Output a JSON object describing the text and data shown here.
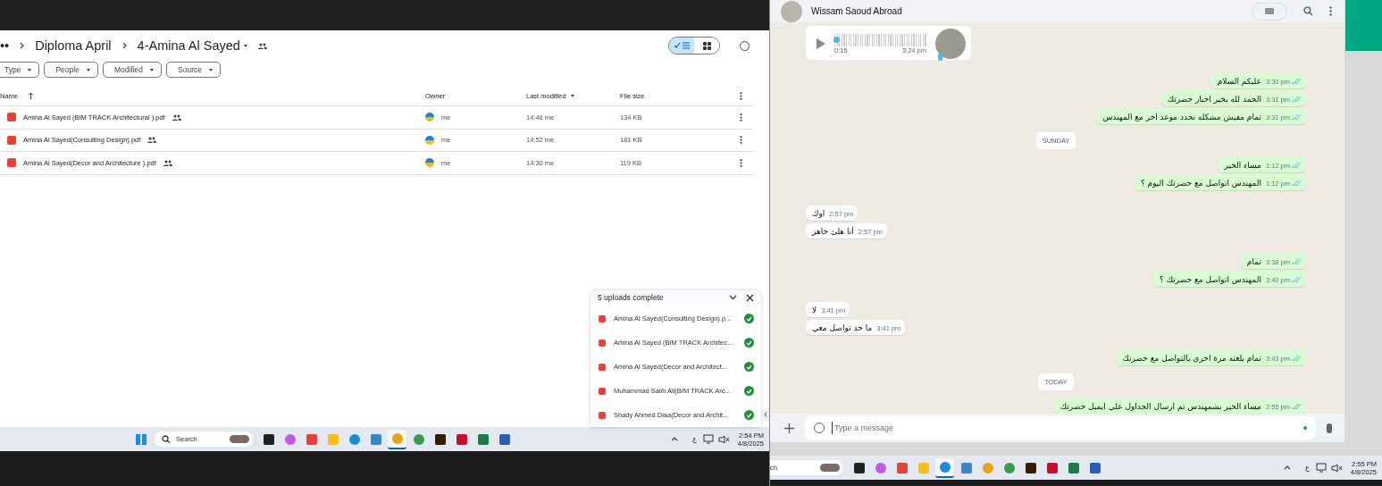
{
  "drive": {
    "breadcrumb": {
      "overflow": "••",
      "parent": "Diploma April",
      "current": "4-Amina Al Sayed"
    },
    "view_toggle": [
      {
        "kind": "list",
        "selected": true
      },
      {
        "kind": "grid",
        "selected": false
      }
    ],
    "filters": [
      "Type",
      "People",
      "Modified",
      "Source"
    ],
    "table": {
      "columns": [
        {
          "label": "Name",
          "sorted": true,
          "descending": false
        },
        {
          "label": "Owner",
          "sorted": false
        },
        {
          "label": "Last modified",
          "sorted": true,
          "descending": true
        },
        {
          "label": "File size",
          "sorted": false
        }
      ],
      "rows": [
        {
          "name": "Amina Al Sayed (BIM TRACK Architectural ).pdf",
          "shared": true,
          "owner": "me",
          "modified": "14:46 me",
          "size": "134 KB"
        },
        {
          "name": "Amina Al Sayed(Consulting Design).pdf",
          "shared": true,
          "owner": "me",
          "modified": "14:52 me",
          "size": "181 KB"
        },
        {
          "name": "Amina Al Sayed(Decor and Architecture ).pdf",
          "shared": true,
          "owner": "me",
          "modified": "14:30 me",
          "size": "119 KB"
        }
      ]
    },
    "uploads": {
      "title": "5 uploads complete",
      "items": [
        {
          "name": "Amina Al Sayed(Consulting Design).p...",
          "done": true
        },
        {
          "name": "Amina Al Sayed (BIM TRACK Architec...",
          "done": true
        },
        {
          "name": "Amina Al Sayed(Decor and Architect...",
          "done": true
        },
        {
          "name": "Muhammad Salih Ali(BIM TRACK Arc...",
          "done": true
        },
        {
          "name": "Shady Ahmed Diaa(Decor and Archit...",
          "done": true
        }
      ]
    },
    "taskbar": {
      "search": "Search",
      "lang": "ع",
      "time": "2:54 PM",
      "date": "4/8/2025",
      "apps": [
        {
          "selected": false
        },
        {
          "selected": false
        },
        {
          "selected": false
        },
        {
          "selected": false
        },
        {
          "selected": false
        },
        {
          "selected": false
        },
        {
          "selected": true
        },
        {
          "selected": false
        },
        {
          "selected": false
        },
        {
          "selected": false
        },
        {
          "selected": false
        },
        {
          "selected": false
        }
      ]
    }
  },
  "chat": {
    "contact": "Wissam Saoud Abroad",
    "voice": {
      "duration": "0:15",
      "time": "3:24 pm",
      "level": 0.02
    },
    "messages": [
      {
        "kind": "out",
        "text": "عليكم السلام",
        "time": "3:30 pm",
        "read": true
      },
      {
        "kind": "out",
        "text": "الحمد لله بخير اخبار حضرتك",
        "time": "3:31 pm",
        "read": true
      },
      {
        "kind": "out",
        "text": "تمام مفيش مشكله نحدد موعد اخر مع المهندس",
        "time": "3:31 pm",
        "read": true
      },
      {
        "kind": "date",
        "text": "SUNDAY"
      },
      {
        "kind": "out",
        "text": "مساء الخير",
        "time": "1:12 pm",
        "read": true
      },
      {
        "kind": "out",
        "text": "المهندس  اتواصل مع حضرتك اليوم ؟",
        "time": "1:12 pm",
        "read": true
      },
      {
        "kind": "in",
        "text": "اوك",
        "time": "2:57 pm"
      },
      {
        "kind": "in",
        "text": "أنا هلئ جاهز",
        "time": "2:57 pm"
      },
      {
        "kind": "out",
        "text": "تمام",
        "time": "3:38 pm",
        "read": true
      },
      {
        "kind": "out",
        "text": "المهندس اتواصل مع حضرتك ؟",
        "time": "3:40 pm",
        "read": true
      },
      {
        "kind": "in",
        "text": "لا",
        "time": "3:41 pm"
      },
      {
        "kind": "in",
        "text": "ما حد تواصل معي",
        "time": "3:41 pm"
      },
      {
        "kind": "out",
        "text": "تمام بلغته مرة اخري بالتواصل مع حضرتك",
        "time": "3:43 pm",
        "read": true
      },
      {
        "kind": "date",
        "text": "TODAY"
      },
      {
        "kind": "out",
        "text": "مساء الخير بشمهندس تم ارسال الجداول علي ايميل حضرتك",
        "time": "2:55 pm",
        "read": false
      }
    ],
    "input": {
      "placeholder": "Type a message"
    },
    "taskbar": {
      "search": "ch",
      "lang": "ع",
      "time": "2:55 PM",
      "date": "4/8/2025",
      "apps": [
        {
          "selected": false
        },
        {
          "selected": false
        },
        {
          "selected": false
        },
        {
          "selected": false
        },
        {
          "selected": true
        },
        {
          "selected": false
        },
        {
          "selected": false
        },
        {
          "selected": false
        },
        {
          "selected": false
        },
        {
          "selected": false
        },
        {
          "selected": false
        },
        {
          "selected": false
        }
      ]
    }
  }
}
